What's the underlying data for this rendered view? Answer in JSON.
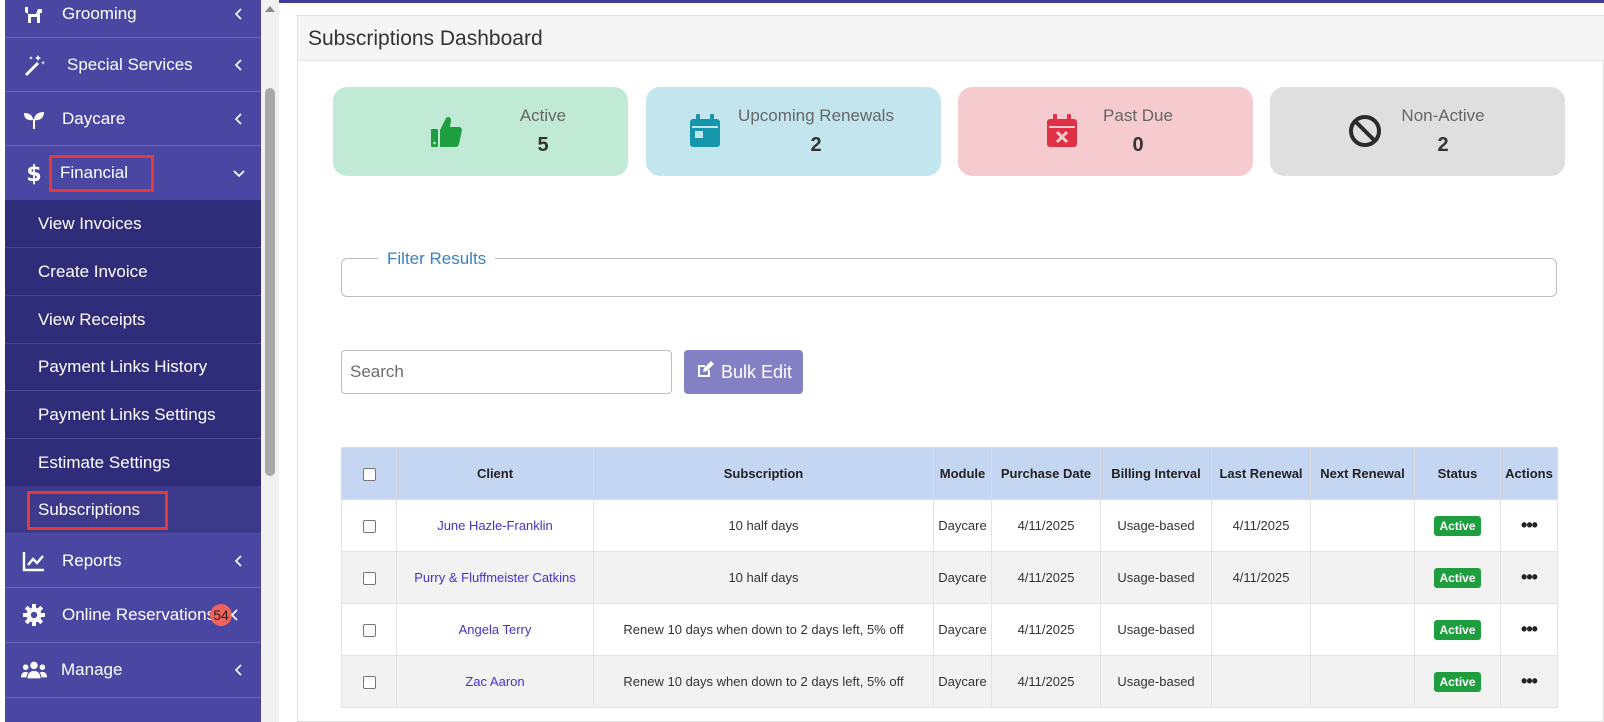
{
  "sidebar": {
    "items": [
      {
        "label": "Grooming",
        "icon": "dog-icon"
      },
      {
        "label": "Special Services",
        "icon": "magic-wand-icon"
      },
      {
        "label": "Daycare",
        "icon": "seedling-icon"
      },
      {
        "label": "Financial",
        "icon": "dollar-icon"
      },
      {
        "label": "Reports",
        "icon": "chart-line-icon"
      },
      {
        "label": "Online Reservations",
        "icon": "gear-icon",
        "badge": "54"
      },
      {
        "label": "Manage",
        "icon": "users-icon"
      }
    ],
    "financial_submenu": [
      "View Invoices",
      "Create Invoice",
      "View Receipts",
      "Payment Links History",
      "Payment Links Settings",
      "Estimate Settings",
      "Subscriptions"
    ]
  },
  "page": {
    "title": "Subscriptions Dashboard"
  },
  "cards": [
    {
      "label": "Active",
      "value": "5",
      "icon": "thumbs-up-icon",
      "bg": "#c1ead6",
      "icon_color": "#1e9e3e"
    },
    {
      "label": "Upcoming Renewals",
      "value": "2",
      "icon": "calendar-icon",
      "bg": "#c3e6ee",
      "icon_color": "#1596ab"
    },
    {
      "label": "Past Due",
      "value": "0",
      "icon": "calendar-x-icon",
      "bg": "#f6cbd0",
      "icon_color": "#e03045"
    },
    {
      "label": "Non-Active",
      "value": "2",
      "icon": "ban-icon",
      "bg": "#dfdfdf",
      "icon_color": "#2b2b2b"
    }
  ],
  "filter": {
    "legend": "Filter Results"
  },
  "search": {
    "placeholder": "Search"
  },
  "bulk_edit_label": "Bulk Edit",
  "table": {
    "headers": [
      "Client",
      "Subscription",
      "Module",
      "Purchase Date",
      "Billing Interval",
      "Last Renewal",
      "Next Renewal",
      "Status",
      "Actions"
    ],
    "rows": [
      {
        "client": "June Hazle-Franklin",
        "subscription": "10 half days",
        "module": "Daycare",
        "purchase_date": "4/11/2025",
        "billing_interval": "Usage-based",
        "last_renewal": "4/11/2025",
        "next_renewal": "",
        "status": "Active"
      },
      {
        "client": "Purry & Fluffmeister Catkins",
        "subscription": "10 half days",
        "module": "Daycare",
        "purchase_date": "4/11/2025",
        "billing_interval": "Usage-based",
        "last_renewal": "4/11/2025",
        "next_renewal": "",
        "status": "Active"
      },
      {
        "client": "Angela Terry",
        "subscription": "Renew 10 days when down to 2 days left, 5% off",
        "module": "Daycare",
        "purchase_date": "4/11/2025",
        "billing_interval": "Usage-based",
        "last_renewal": "",
        "next_renewal": "",
        "status": "Active"
      },
      {
        "client": "Zac Aaron",
        "subscription": "Renew 10 days when down to 2 days left, 5% off",
        "module": "Daycare",
        "purchase_date": "4/11/2025",
        "billing_interval": "Usage-based",
        "last_renewal": "",
        "next_renewal": "",
        "status": "Active"
      }
    ],
    "actions_glyph": "•••"
  }
}
